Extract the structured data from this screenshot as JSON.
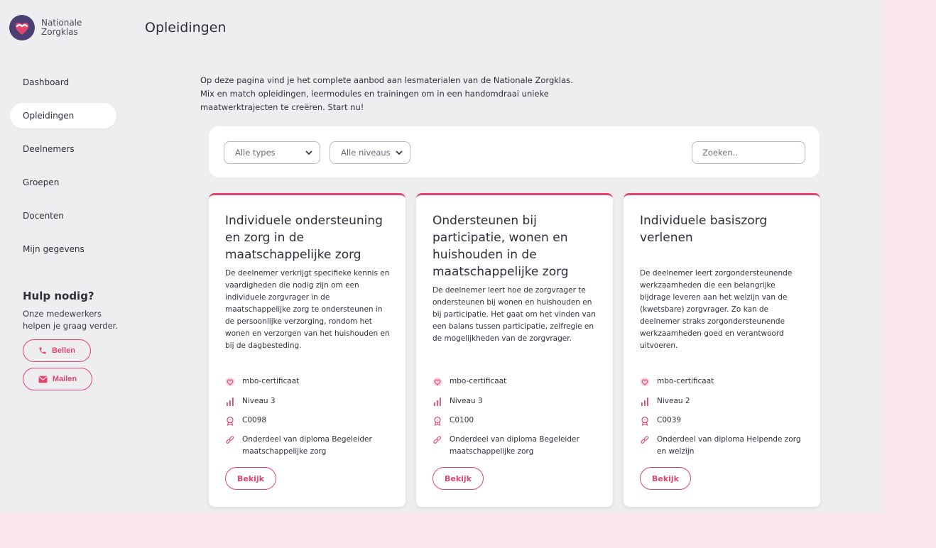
{
  "brand": {
    "line1": "Nationale",
    "line2": "Zorgklas",
    "accent": "#e0456d"
  },
  "page": {
    "title": "Opleidingen",
    "intro": "Op deze pagina vind je het complete aanbod aan lesmaterialen van de Nationale Zorgklas. Mix en match opleidingen, leermodules en trainingen om in een handomdraai unieke maatwerktrajecten te creëren. Start nu!"
  },
  "sidebar": {
    "items": [
      {
        "label": "Dashboard"
      },
      {
        "label": "Opleidingen",
        "active": true
      },
      {
        "label": "Deelnemers"
      },
      {
        "label": "Groepen"
      },
      {
        "label": "Docenten"
      },
      {
        "label": "Mijn gegevens"
      }
    ],
    "help": {
      "title": "Hulp nodig?",
      "text": "Onze medewerkers helpen je graag verder.",
      "call_label": "Bellen",
      "mail_label": "Mailen"
    }
  },
  "filters": {
    "types": "Alle types",
    "levels": "Alle niveaus",
    "search_placeholder": "Zoeken.."
  },
  "cards": [
    {
      "title": "Individuele ondersteuning en zorg in de maatschappelijke zorg",
      "description": "De deelnemer verkrijgt specifieke kennis en vaardigheden die nodig zijn om een individuele zorgvrager in de maatschappelijke zorg te ondersteunen in de persoonlijke verzorging, rondom het wonen en verzorgen van het huishouden en bij de dagbesteding.",
      "certificate": "mbo-certificaat",
      "level": "Niveau 3",
      "code": "C0098",
      "diploma": "Onderdeel van diploma Begeleider maatschappelijke zorg",
      "button": "Bekijk"
    },
    {
      "title": "Ondersteunen bij participatie, wonen en huishouden in de maatschappelijke zorg",
      "description": "De deelnemer leert hoe de zorgvrager te ondersteunen bij wonen en huishouden en bij participatie. Het gaat om het vinden van een balans tussen participatie, zelfregie en de mogelijkheden van de zorgvrager.",
      "certificate": "mbo-certificaat",
      "level": "Niveau 3",
      "code": "C0100",
      "diploma": "Onderdeel van diploma Begeleider maatschappelijke zorg",
      "button": "Bekijk"
    },
    {
      "title": "Individuele basiszorg verlenen",
      "description": "De deelnemer leert zorgondersteunende werkzaamheden die een belangrijke bijdrage leveren aan het welzijn van de (kwetsbare) zorgvrager. Zo kan de deelnemer straks zorgondersteunende werkzaamheden goed en verantwoord uitvoeren.",
      "certificate": "mbo-certificaat",
      "level": "Niveau 2",
      "code": "C0039",
      "diploma": "Onderdeel van diploma Helpende zorg en welzijn",
      "button": "Bekijk"
    }
  ]
}
